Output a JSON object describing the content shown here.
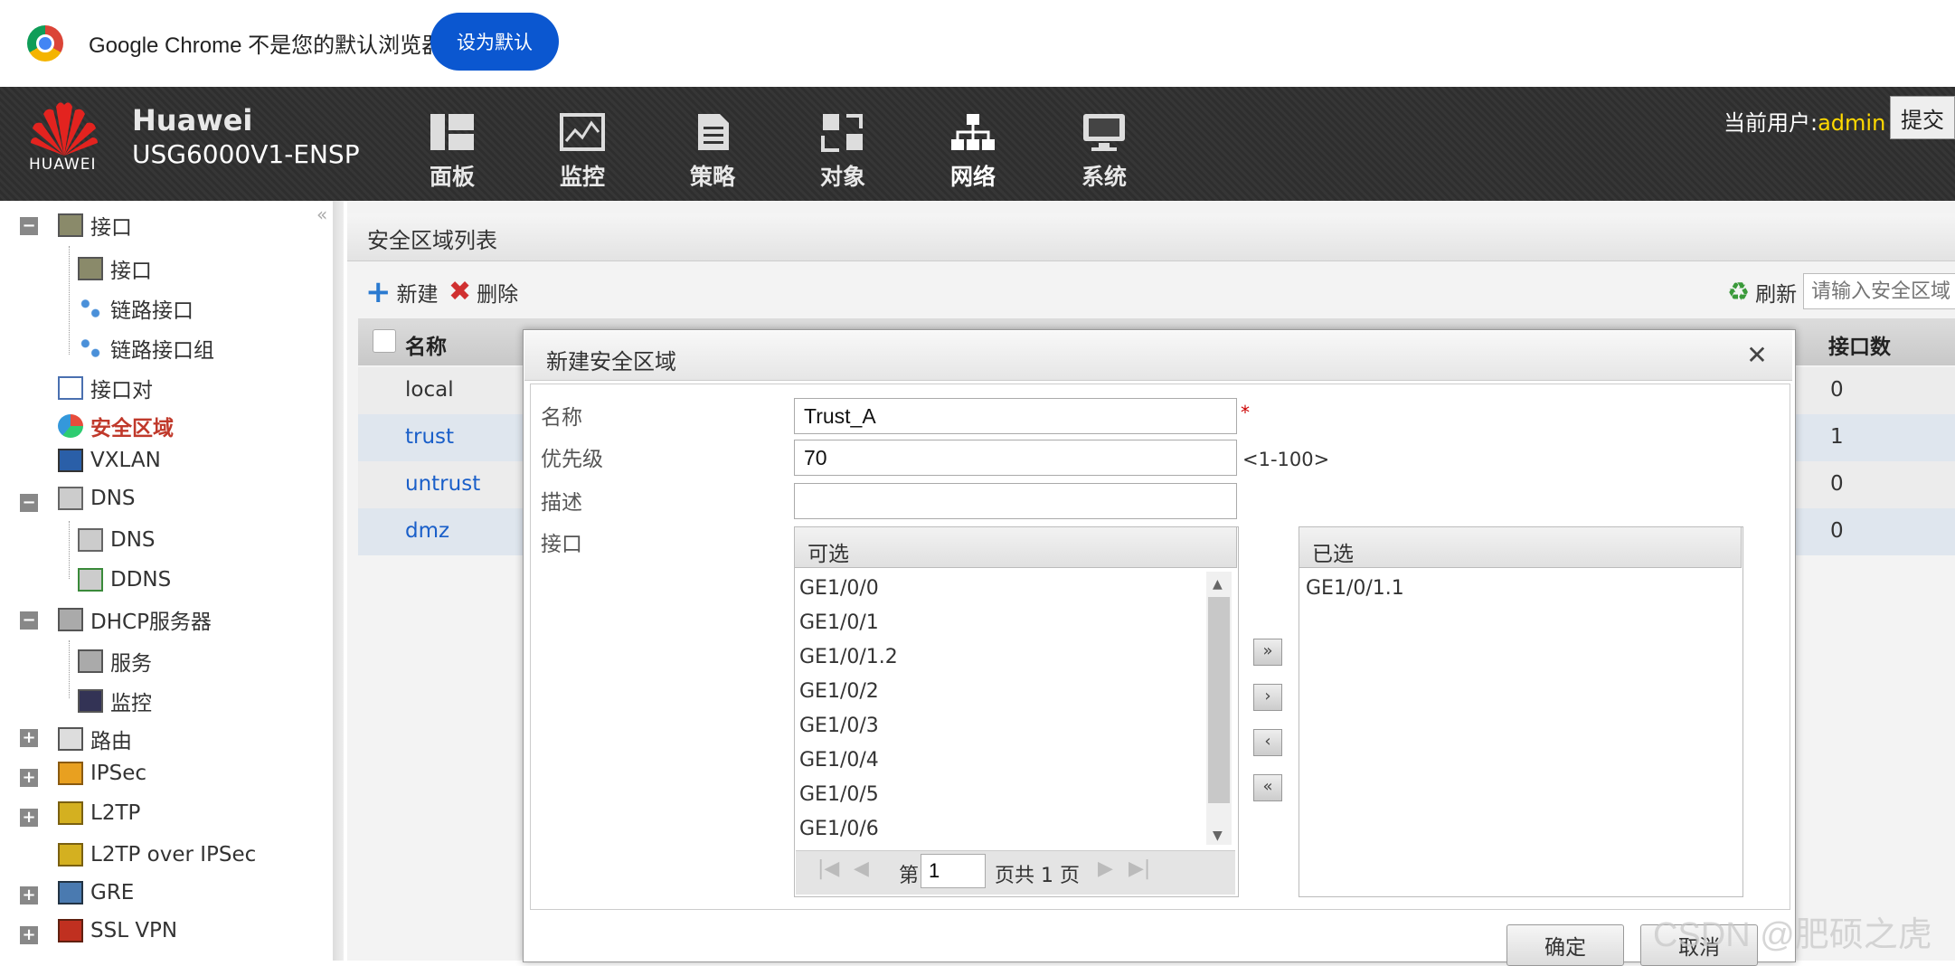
{
  "chrome_bar": {
    "message": "Google Chrome 不是您的默认浏览器",
    "set_default_label": "设为默认"
  },
  "header": {
    "logo_text": "HUAWEI",
    "brand_name": "Huawei",
    "brand_model": "USG6000V1-ENSP",
    "nav": [
      {
        "label": "面板",
        "icon": "dashboard-icon"
      },
      {
        "label": "监控",
        "icon": "monitor-icon"
      },
      {
        "label": "策略",
        "icon": "policy-icon"
      },
      {
        "label": "对象",
        "icon": "object-icon"
      },
      {
        "label": "网络",
        "icon": "network-icon"
      },
      {
        "label": "系统",
        "icon": "system-icon"
      }
    ],
    "current_user_label": "当前用户:",
    "current_user_name": "admin",
    "submit_label": "提交"
  },
  "sidebar": {
    "items": [
      {
        "label": "接口",
        "icon": "interface-icon"
      },
      {
        "label": "接口",
        "icon": "interface-icon"
      },
      {
        "label": "链路接口",
        "icon": "link-interface-icon"
      },
      {
        "label": "链路接口组",
        "icon": "link-group-icon"
      },
      {
        "label": "接口对",
        "icon": "interface-pair-icon"
      },
      {
        "label": "安全区域",
        "icon": "security-zone-icon"
      },
      {
        "label": "VXLAN",
        "icon": "vxlan-icon"
      },
      {
        "label": "DNS",
        "icon": "dns-icon"
      },
      {
        "label": "DNS",
        "icon": "dns-icon"
      },
      {
        "label": "DDNS",
        "icon": "ddns-icon"
      },
      {
        "label": "DHCP服务器",
        "icon": "dhcp-icon"
      },
      {
        "label": "服务",
        "icon": "service-icon"
      },
      {
        "label": "监控",
        "icon": "monitor-icon"
      },
      {
        "label": "路由",
        "icon": "route-icon"
      },
      {
        "label": "IPSec",
        "icon": "ipsec-icon"
      },
      {
        "label": "L2TP",
        "icon": "l2tp-icon"
      },
      {
        "label": "L2TP over IPSec",
        "icon": "l2tp-ipsec-icon"
      },
      {
        "label": "GRE",
        "icon": "gre-icon"
      },
      {
        "label": "SSL VPN",
        "icon": "ssl-vpn-icon"
      }
    ]
  },
  "main": {
    "title": "安全区域列表",
    "new_label": "新建",
    "delete_label": "删除",
    "refresh_label": "刷新",
    "search_placeholder": "请输入安全区域",
    "columns": {
      "name": "名称",
      "interface_count": "接口数"
    },
    "rows": [
      {
        "name": "local",
        "count": "0"
      },
      {
        "name": "trust",
        "count": "1"
      },
      {
        "name": "untrust",
        "count": "0"
      },
      {
        "name": "dmz",
        "count": "0"
      }
    ]
  },
  "dialog": {
    "title": "新建安全区域",
    "name_label": "名称",
    "name_value": "Trust_A",
    "required_mark": "*",
    "priority_label": "优先级",
    "priority_value": "70",
    "priority_range": "<1-100>",
    "desc_label": "描述",
    "desc_value": "",
    "interface_label": "接口",
    "available_header": "可选",
    "selected_header": "已选",
    "available": [
      "GE1/0/0",
      "GE1/0/1",
      "GE1/0/1.2",
      "GE1/0/2",
      "GE1/0/3",
      "GE1/0/4",
      "GE1/0/5",
      "GE1/0/6"
    ],
    "selected": [
      "GE1/0/1.1"
    ],
    "pager": {
      "page_prefix": "第",
      "page_value": "1",
      "page_total": "页共 1 页"
    },
    "move_all_right": "»",
    "move_right": "›",
    "move_left": "‹",
    "move_all_left": "«",
    "ok_label": "确定",
    "cancel_label": "取消"
  },
  "watermark": "CSDN @肥硕之虎",
  "colors": {
    "accent_blue": "#0b57d0",
    "active_red": "#c0392b",
    "link_blue": "#1a5fc9",
    "user_yellow": "#ffd900"
  }
}
